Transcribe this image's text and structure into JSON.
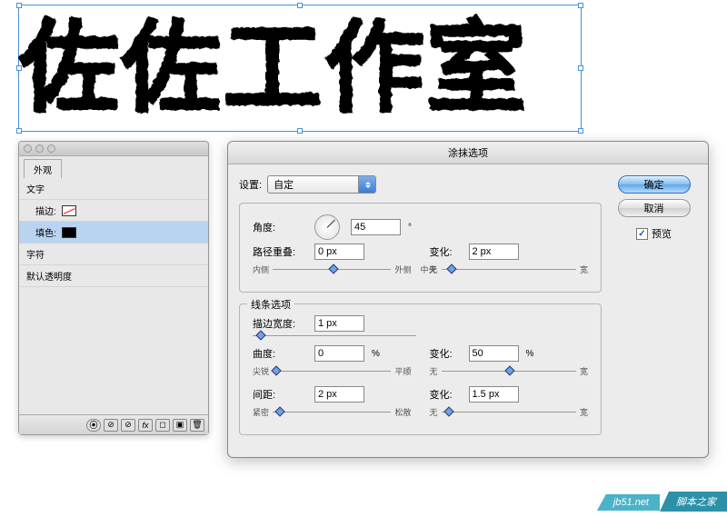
{
  "canvas_text": "佐佐工作室",
  "appearance_panel": {
    "title": "外观",
    "rows": {
      "text": "文字",
      "stroke": "描边:",
      "fill": "填色:",
      "char": "字符",
      "opacity": "默认透明度"
    }
  },
  "dialog": {
    "title": "涂抹选项",
    "setting_label": "设置:",
    "setting_value": "自定",
    "group1": {
      "angle_label": "角度:",
      "angle_value": "45",
      "angle_unit": "°",
      "overlap_label": "路径重叠:",
      "overlap_value": "0 px",
      "overlap_min": "内侧",
      "overlap_mid": "中央",
      "overlap_max": "外侧",
      "var_label": "变化:",
      "var_value": "2 px",
      "var_min": "无",
      "var_max": "宽"
    },
    "group2": {
      "title": "线条选项",
      "strokew_label": "描边宽度:",
      "strokew_value": "1 px",
      "curv_label": "曲度:",
      "curv_value": "0",
      "pct": "%",
      "curv_min": "尖锐",
      "curv_max": "平顺",
      "curv_var_label": "变化:",
      "curv_var_value": "50",
      "curv_var_min": "无",
      "curv_var_max": "宽",
      "space_label": "间距:",
      "space_value": "2 px",
      "space_min": "紧密",
      "space_max": "松散",
      "space_var_label": "变化:",
      "space_var_value": "1.5 px",
      "space_var_min": "无",
      "space_var_max": "宽"
    },
    "buttons": {
      "ok": "确定",
      "cancel": "取消",
      "preview": "预览"
    }
  },
  "badge": {
    "url": "jb51.net",
    "name": "脚本之家"
  }
}
